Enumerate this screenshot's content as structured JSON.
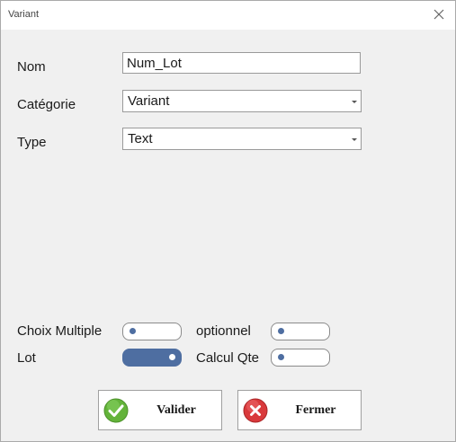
{
  "window": {
    "title": "Variant"
  },
  "form": {
    "nom": {
      "label": "Nom",
      "value": "Num_Lot"
    },
    "categorie": {
      "label": "Catégorie",
      "value": "Variant"
    },
    "type": {
      "label": "Type",
      "value": "Text"
    }
  },
  "toggles": {
    "choix_multiple": {
      "label": "Choix Multiple",
      "checked": false
    },
    "optionnel": {
      "label": "optionnel",
      "checked": false
    },
    "lot": {
      "label": "Lot",
      "checked": true
    },
    "calcul_qte": {
      "label": "Calcul Qte",
      "checked": false
    }
  },
  "buttons": {
    "valider": {
      "label": "Valider",
      "icon": "check-icon"
    },
    "fermer": {
      "label": "Fermer",
      "icon": "close-icon"
    }
  },
  "colors": {
    "accent": "#4e6ea1",
    "valider_icon": "#63b33a",
    "fermer_icon": "#d9393b"
  }
}
